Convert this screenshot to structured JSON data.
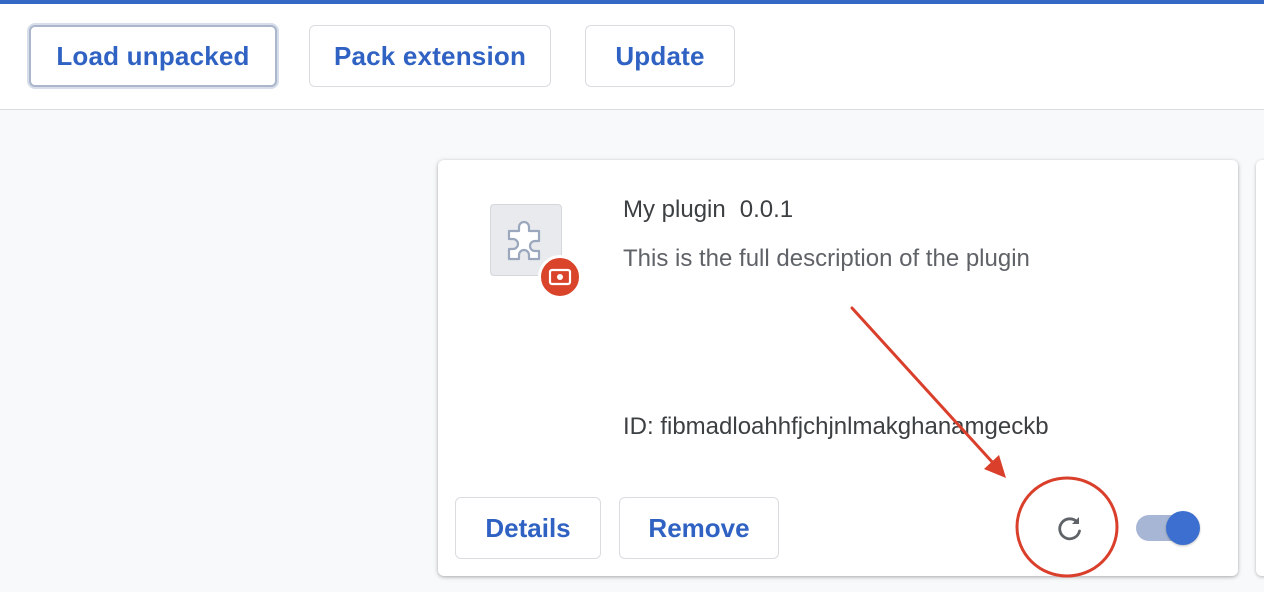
{
  "toolbar": {
    "load_unpacked_label": "Load unpacked",
    "pack_extension_label": "Pack extension",
    "update_label": "Update"
  },
  "extension": {
    "name": "My plugin",
    "version": "0.0.1",
    "description": "This is the full description of the plugin",
    "id_text": "ID: fibmadloahhfjchjnlmakghanamgeckb",
    "enabled": true,
    "details_label": "Details",
    "remove_label": "Remove",
    "icon": "puzzle-piece-icon",
    "badge_icon": "error-badge-icon",
    "reload_icon": "reload-icon"
  },
  "annotation": {
    "color": "#d93f2b",
    "shapes": [
      "arrow-icon",
      "highlight-circle"
    ]
  },
  "colors": {
    "accent": "#3567c5",
    "button_text": "#2f62c2",
    "toggle_on": "#3c6fd0"
  }
}
